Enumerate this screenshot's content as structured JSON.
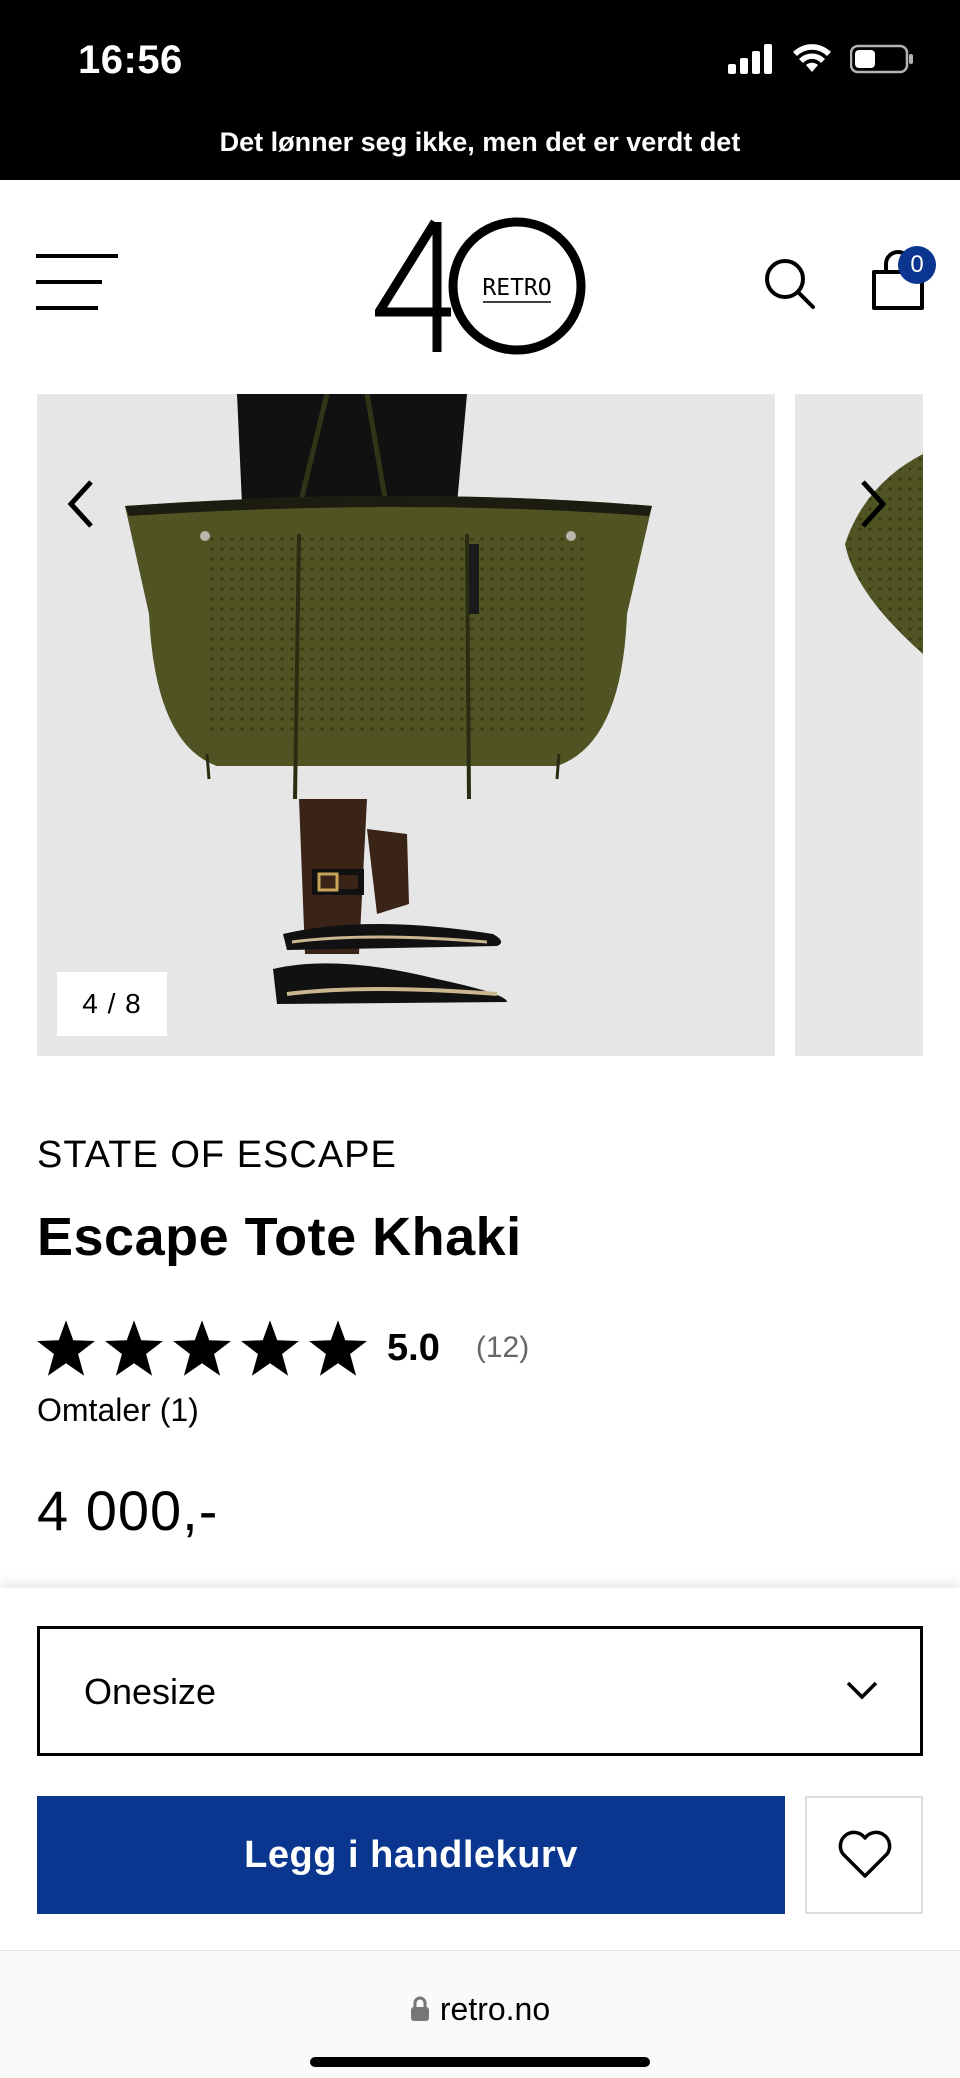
{
  "status_bar": {
    "time": "16:56"
  },
  "promo": {
    "text": "Det lønner seg ikke, men det er verdt det"
  },
  "header": {
    "logo_number": "40",
    "logo_text": "RETRO",
    "cart_count": "0",
    "icons": [
      "menu-icon",
      "search-icon",
      "cart-icon"
    ]
  },
  "gallery": {
    "counter": "4 / 8",
    "current_index": 4,
    "total_images": 8
  },
  "product": {
    "brand": "STATE OF ESCAPE",
    "title": "Escape Tote Khaki",
    "rating_value": "5.0",
    "rating_stars": 5,
    "rating_count": "(12)",
    "reviews_link": "Omtaler (1)",
    "price": "4 000,-"
  },
  "purchase": {
    "size_selected": "Onesize",
    "add_to_cart_label": "Legg i handlekurv",
    "accent_color": "#0b3690"
  },
  "browser": {
    "url": "retro.no"
  }
}
